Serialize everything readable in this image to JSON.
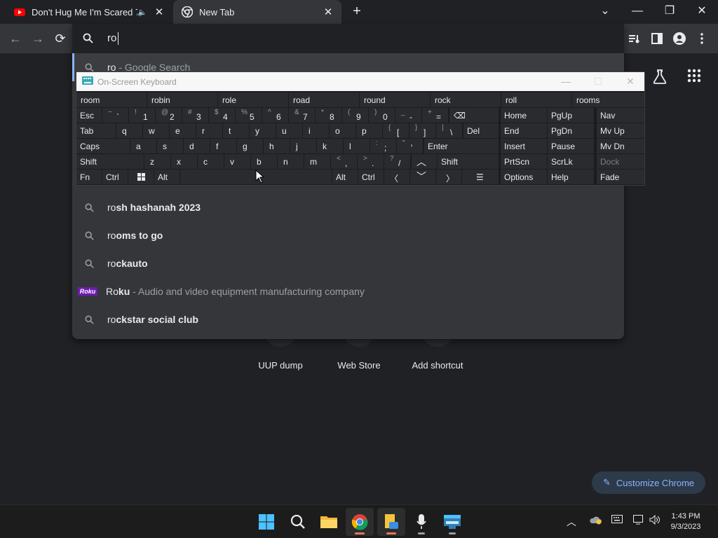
{
  "tabs": [
    {
      "title": "Don't Hug Me I'm Scared 7 -",
      "favicon": "youtube-icon",
      "audio": true
    },
    {
      "title": "New Tab",
      "favicon": "chrome-icon",
      "audio": false
    }
  ],
  "omnibox": {
    "query": "ro",
    "suggestions": [
      {
        "typed": "ro",
        "rest": "",
        "desc": " - Google Search",
        "icon": "search-icon"
      },
      {
        "typed": "ro",
        "rest": "sh hashanah 2023",
        "desc": "",
        "icon": "search-icon"
      },
      {
        "typed": "ro",
        "rest": "oms to go",
        "desc": "",
        "icon": "search-icon"
      },
      {
        "typed": "ro",
        "rest": "ckauto",
        "desc": "",
        "icon": "search-icon"
      },
      {
        "typed": "Ro",
        "rest": "ku",
        "desc": " - Audio and video equipment manufacturing company",
        "icon": "roku-logo"
      },
      {
        "typed": "ro",
        "rest": "ckstar social club",
        "desc": "",
        "icon": "search-icon"
      }
    ]
  },
  "ntp": {
    "shortcuts": [
      "UUP dump",
      "Web Store",
      "Add shortcut"
    ],
    "customize_label": "Customize Chrome"
  },
  "osk": {
    "title": "On-Screen Keyboard",
    "predictions": [
      "room",
      "robin",
      "role",
      "road",
      "round",
      "rock",
      "roll",
      "rooms"
    ],
    "keys": {
      "esc": "Esc",
      "tab": "Tab",
      "caps": "Caps",
      "shift": "Shift",
      "fn": "Fn",
      "ctrl": "Ctrl",
      "alt": "Alt",
      "del": "Del",
      "enter": "Enter",
      "altgr": "Alt",
      "ctrl_r": "Ctrl",
      "shift_r": "Shift",
      "home": "Home",
      "pgup": "PgUp",
      "nav": "Nav",
      "end": "End",
      "pgdn": "PgDn",
      "mvup": "Mv Up",
      "insert": "Insert",
      "pause": "Pause",
      "mvdn": "Mv Dn",
      "prtscn": "PrtScn",
      "scrlk": "ScrLk",
      "dock": "Dock",
      "options": "Options",
      "help": "Help",
      "fade": "Fade",
      "row1": [
        [
          "~",
          "`"
        ],
        [
          "!",
          "1"
        ],
        [
          "@",
          "2"
        ],
        [
          "#",
          "3"
        ],
        [
          "$",
          "4"
        ],
        [
          "%",
          "5"
        ],
        [
          "^",
          "6"
        ],
        [
          "&",
          "7"
        ],
        [
          "*",
          "8"
        ],
        [
          "(",
          "9"
        ],
        [
          ")",
          "0"
        ],
        [
          "_",
          "-"
        ],
        [
          "+",
          "="
        ]
      ],
      "row2": [
        "q",
        "w",
        "e",
        "r",
        "t",
        "y",
        "u",
        "i",
        "o",
        "p"
      ],
      "row2_extra": [
        [
          "{",
          "["
        ],
        [
          "}",
          "]"
        ],
        [
          "|",
          "\\"
        ]
      ],
      "row3": [
        "a",
        "s",
        "d",
        "f",
        "g",
        "h",
        "j",
        "k",
        "l"
      ],
      "row3_extra": [
        [
          ":",
          ";"
        ],
        [
          "\"",
          "'"
        ]
      ],
      "row4": [
        "z",
        "x",
        "c",
        "v",
        "b",
        "n",
        "m"
      ],
      "row4_extra": [
        [
          "<",
          ","
        ],
        [
          ">",
          "."
        ],
        [
          "?",
          "/"
        ]
      ]
    }
  },
  "taskbar": {
    "time": "1:43 PM",
    "date": "9/3/2023"
  },
  "colors": {
    "accent": "#8ab4f8",
    "bg": "#202124",
    "toolbar": "#35363a"
  }
}
